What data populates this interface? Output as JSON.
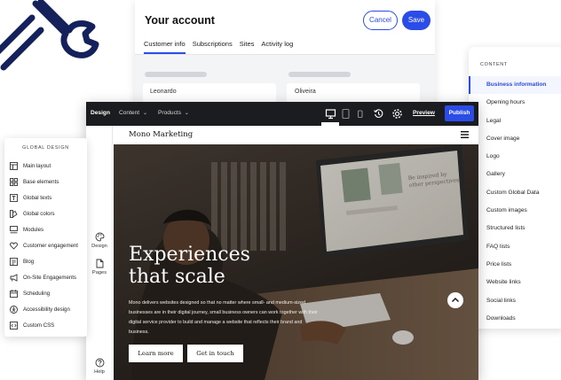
{
  "colors": {
    "accent": "#2b4ce6",
    "topbar": "#1b1c1f",
    "logo": "#14215a"
  },
  "account": {
    "title": "Your account",
    "cancel_label": "Cancel",
    "save_label": "Save",
    "tabs": [
      {
        "label": "Customer info",
        "active": true
      },
      {
        "label": "Subscriptions",
        "active": false
      },
      {
        "label": "Sites",
        "active": false
      },
      {
        "label": "Activity log",
        "active": false
      }
    ],
    "first_name": "Leonardo",
    "last_name": "Oliveira"
  },
  "content_panel": {
    "heading": "CONTENT",
    "items": [
      {
        "label": "Business information",
        "active": true
      },
      {
        "label": "Opening hours"
      },
      {
        "label": "Legal"
      },
      {
        "label": "Cover image"
      },
      {
        "label": "Logo"
      },
      {
        "label": "Gallery"
      },
      {
        "label": "Custom Global Data"
      },
      {
        "label": "Custom images"
      },
      {
        "label": "Structured lists"
      },
      {
        "label": "FAQ lists"
      },
      {
        "label": "Price lists"
      },
      {
        "label": "Website links"
      },
      {
        "label": "Social links"
      },
      {
        "label": "Downloads"
      }
    ]
  },
  "editor": {
    "topbar": {
      "design_label": "Design",
      "content_menu": "Content",
      "products_menu": "Products",
      "preview_label": "Preview",
      "publish_label": "Publish",
      "device_icons": [
        "desktop-icon",
        "tablet-icon",
        "mobile-icon"
      ],
      "active_device": "desktop"
    },
    "rail": {
      "design_label": "Design",
      "pages_label": "Pages",
      "help_label": "Help"
    },
    "site": {
      "brand": "Mono Marketing",
      "hero_title_line1": "Experiences",
      "hero_title_line2": "that scale",
      "hero_text": "Mono delivers websites designed so that no matter where small- and medium-sized businesses are in their digital journey, small business owners can work together with their digital service provider to build and manage a website that reflects their brand and business.",
      "learn_more_label": "Learn more",
      "get_in_touch_label": "Get in touch",
      "screen_text_line1": "Be inspired by",
      "screen_text_line2": "other perspectives"
    }
  },
  "global_design": {
    "heading": "GLOBAL DESIGN",
    "items": [
      {
        "label": "Main layout",
        "icon": "layout-icon"
      },
      {
        "label": "Base elements",
        "icon": "grid-icon"
      },
      {
        "label": "Global texts",
        "icon": "text-icon"
      },
      {
        "label": "Global colors",
        "icon": "palette-icon"
      },
      {
        "label": "Modules",
        "icon": "modules-icon"
      },
      {
        "label": "Customer engagement",
        "icon": "heart-icon"
      },
      {
        "label": "Blog",
        "icon": "blog-icon"
      },
      {
        "label": "On-Site Engagements",
        "icon": "megaphone-icon"
      },
      {
        "label": "Scheduling",
        "icon": "calendar-icon"
      },
      {
        "label": "Accessibility design",
        "icon": "accessibility-icon"
      },
      {
        "label": "Custom CSS",
        "icon": "css-icon"
      }
    ]
  }
}
